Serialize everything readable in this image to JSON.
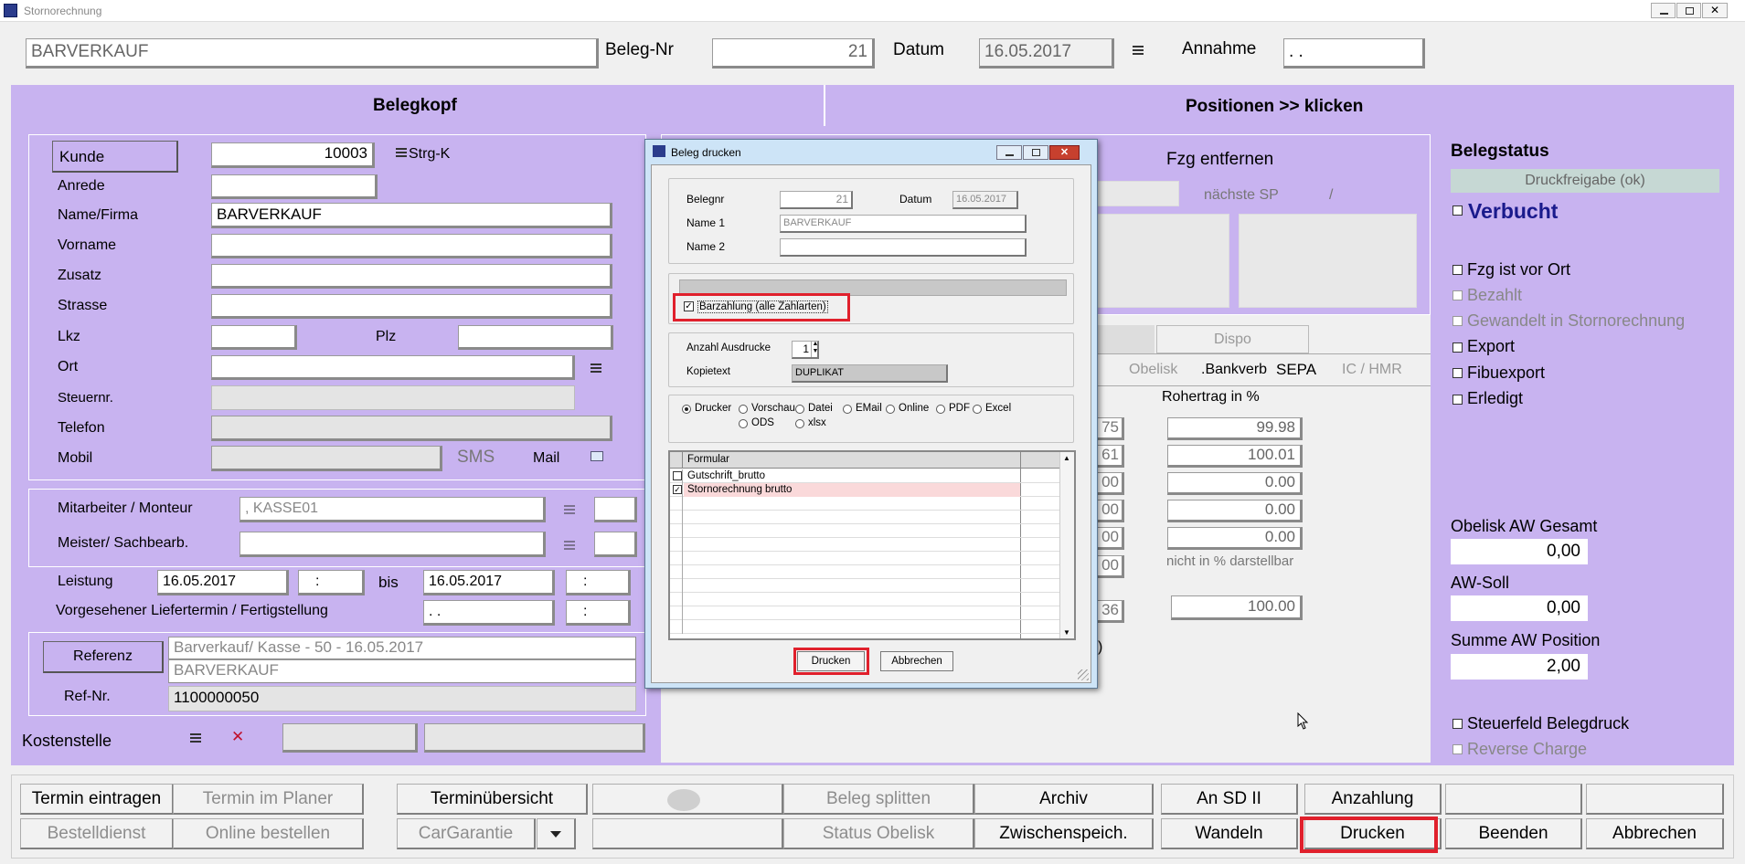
{
  "window": {
    "title": "Stornorechnung"
  },
  "header": {
    "customer_name": "BARVERKAUF",
    "beleg_nr_label": "Beleg-Nr",
    "beleg_nr": "21",
    "datum_label": "Datum",
    "datum": "16.05.2017",
    "annahme_label": "Annahme",
    "annahme": " .  ."
  },
  "tabs": {
    "belegkopf": "Belegkopf",
    "positionen": "Positionen >> klicken"
  },
  "customer": {
    "kunde_label": "Kunde",
    "kunde": "10003",
    "strg_k": "Strg-K",
    "anrede": "Anrede",
    "name_firma": "Name/Firma",
    "name_value": "BARVERKAUF",
    "vorname": "Vorname",
    "zusatz": "Zusatz",
    "strasse": "Strasse",
    "lkz": "Lkz",
    "plz": "Plz",
    "ort": "Ort",
    "steuernr": "Steuernr.",
    "telefon": "Telefon",
    "mobil": "Mobil",
    "sms": "SMS",
    "mail": "Mail"
  },
  "staff": {
    "mitarbeiter_label": "Mitarbeiter / Monteur",
    "mitarbeiter_value": ", KASSE01",
    "meister_label": "Meister/ Sachbearb.",
    "leistung_label": "Leistung",
    "leistung_from": "16.05.2017",
    "time_sep": ":",
    "bis_label": "bis",
    "leistung_to": "16.05.2017",
    "liefertermin_label": "Vorgesehener Liefertermin / Fertigstellung",
    "liefertermin": " .  ."
  },
  "reference": {
    "referenz_button": "Referenz",
    "line1": "Barverkauf/ Kasse - 50 - 16.05.2017",
    "line2": "BARVERKAUF",
    "refnr_label": "Ref-Nr.",
    "refnr": "1100000050"
  },
  "kostenstelle": {
    "label": "Kostenstelle",
    "delete": "✕"
  },
  "middle": {
    "fzg_entfernen": "Fzg entfernen",
    "naechste_sp": "nächste SP",
    "slash": "/",
    "dispo_tab": "Dispo",
    "tabs": [
      "n",
      "Obelisk",
      ".Bankverb",
      "SEPA",
      "IC / HMR"
    ],
    "rohertrag_label": "Rohertrag in %",
    "left_values": [
      "75",
      "61",
      "00",
      "00",
      "00",
      "00",
      "36"
    ],
    "rohertrag_values": [
      "99.98",
      "100.01",
      "0.00",
      "0.00",
      "0.00"
    ],
    "nicht_darstellbar": "nicht in % darstellbar",
    "total": "100.00",
    "k_text": "k)"
  },
  "status": {
    "title": "Belegstatus",
    "freigabe": "Druckfreigabe (ok)",
    "verbucht": "Verbucht",
    "fzg_vor_ort": "Fzg ist vor Ort",
    "bezahlt": "Bezahlt",
    "gewandelt": "Gewandelt in Stornorechnung",
    "export": "Export",
    "fibuexport": "Fibuexport",
    "erledigt": "Erledigt",
    "obelisk_aw_label": "Obelisk AW Gesamt",
    "obelisk_aw": "0,00",
    "aw_soll_label": "AW-Soll",
    "aw_soll": "0,00",
    "summe_aw_label": "Summe AW Position",
    "summe_aw": "2,00",
    "steuerfeld": "Steuerfeld Belegdruck",
    "reverse_charge": "Reverse Charge"
  },
  "dialog": {
    "title": "Beleg drucken",
    "belegnr_label": "Belegnr",
    "belegnr": "21",
    "datum_label": "Datum",
    "datum": "16.05.2017",
    "name1_label": "Name 1",
    "name1": "BARVERKAUF",
    "name2_label": "Name 2",
    "barzahlung": "Barzahlung (alle Zahlarten)",
    "anzahl_label": "Anzahl Ausdrucke",
    "anzahl": "1",
    "kopietext_label": "Kopietext",
    "kopietext": "DUPLIKAT",
    "outputs": [
      "Drucker",
      "Vorschau",
      "Datei",
      "EMail",
      "Online",
      "PDF",
      "Excel",
      "ODS",
      "xlsx"
    ],
    "formular_header": "Formular",
    "formulare": [
      "Gutschrift_brutto",
      "Stornorechnung brutto"
    ],
    "drucken": "Drucken",
    "abbrechen": "Abbrechen"
  },
  "bottom": {
    "row1": [
      "Termin eintragen",
      "Termin im Planer",
      "Terminübersicht",
      "",
      "Beleg splitten",
      "Archiv",
      "An SD II",
      "Anzahlung",
      "",
      ""
    ],
    "row2": [
      "Bestelldienst",
      "Online bestellen",
      "CarGarantie",
      "",
      "Status Obelisk",
      "Zwischenspeich.",
      "Wandeln",
      "Drucken",
      "Beenden",
      "Abbrechen"
    ]
  },
  "colors": {
    "accent": "#c8b3f0",
    "highlight": "#e0202c",
    "title_blue": "#1a1a8c"
  }
}
